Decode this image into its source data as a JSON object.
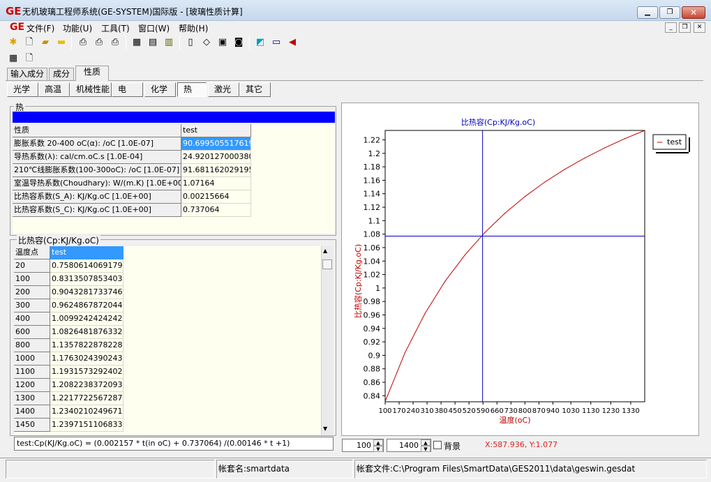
{
  "window": {
    "logo": "GE",
    "title": "无机玻璃工程师系统(GE-SYSTEM)国际版 - [玻璃性质计算]"
  },
  "menu": {
    "logo": "GE",
    "items": [
      "文件(F)",
      "功能(U)",
      "工具(T)",
      "窗口(W)",
      "帮助(H)"
    ]
  },
  "toolbar": {
    "icons": [
      "run-icon",
      "new-file-icon",
      "open-folder-icon",
      "folder-icon",
      "print-setup-icon",
      "print-icon",
      "print-preview-icon",
      "grid-icon",
      "form-icon",
      "database-icon",
      "calculator-icon",
      "eraser-icon",
      "document-icon",
      "disk-icon",
      "book-icon",
      "keyboard-icon",
      "speaker-icon",
      "table-icon",
      "report-preview-icon"
    ]
  },
  "tabs": {
    "primary": [
      "输入成分",
      "成分",
      "性质"
    ],
    "primary_active": 2,
    "secondary": [
      "光学",
      "高温",
      "机械性能",
      "电",
      "化学",
      "热",
      "激光",
      "其它"
    ],
    "secondary_active": 5
  },
  "heat_group": {
    "label": "热",
    "bar_color": "#0000ff",
    "header": [
      "性质",
      "test"
    ],
    "rows": [
      [
        "膨胀系数 20-400 oC(α): /oC [1.0E-07]",
        "90.6995055176196"
      ],
      [
        "导热系数(λ): cal/cm.oC.s [1.0E-04]",
        "24.9201270003803"
      ],
      [
        "210℃线膨胀系数(100-300oC): /oC [1.0E-07]",
        "91.681162029195"
      ],
      [
        "室温导热系数(Choudhary): W/(m.K) [1.0E+00]",
        "1.07164"
      ],
      [
        "比热容系数(S_A): KJ/Kg.oC [1.0E+00]",
        "0.00215664"
      ],
      [
        "比热容系数(S_C): KJ/Kg.oC [1.0E+00]",
        "0.737064"
      ]
    ]
  },
  "cp_group": {
    "label": "比热容(Cp:KJ/Kg.oC)",
    "header": [
      "温度点",
      "test"
    ],
    "rows": [
      [
        "20",
        "0.758061406917995"
      ],
      [
        "100",
        "0.831350785340314"
      ],
      [
        "200",
        "0.904328173374613"
      ],
      [
        "300",
        "0.96248678720445"
      ],
      [
        "400",
        "1.00992424242424"
      ],
      [
        "600",
        "1.08264818763326"
      ],
      [
        "800",
        "1.13578228782288"
      ],
      [
        "1000",
        "1.17630243902439"
      ],
      [
        "1100",
        "1.19315732924021"
      ],
      [
        "1200",
        "1.2082238372093"
      ],
      [
        "1300",
        "1.22177225672878"
      ],
      [
        "1400",
        "1.23402102496715"
      ],
      [
        "1450",
        "1.23971511068335"
      ]
    ],
    "formula": "test:Cp(KJ/Kg.oC) = (0.002157 * t(in oC) + 0.737064) /(0.00146 * t +1)"
  },
  "chart_controls": {
    "min": "100",
    "max": "1400",
    "background_label": "背景",
    "cursor_readout": "X:587.936, Y:1.077"
  },
  "status": {
    "account_name": "帐套名:smartdata",
    "account_file": "帐套文件:C:\\Program Files\\SmartData\\GES2011\\data\\geswin.gesdat"
  },
  "chart_data": {
    "type": "line",
    "title": "比热容(Cp:KJ/Kg.oC)",
    "xlabel": "温度(oC)",
    "ylabel": "比热容(Cp:KJ/Kg.oC)",
    "x_ticks": [
      "100",
      "170",
      "240",
      "310",
      "380",
      "450",
      "520",
      "590",
      "660",
      "730",
      "800",
      "870",
      "940",
      "1030",
      "1130",
      "1230",
      "1330"
    ],
    "y_ticks": [
      "0.84",
      "0.86",
      "0.88",
      "0.9",
      "0.92",
      "0.94",
      "0.96",
      "0.98",
      "1",
      "1.02",
      "1.04",
      "1.06",
      "1.08",
      "1.1",
      "1.12",
      "1.14",
      "1.16",
      "1.18",
      "1.2",
      "1.22"
    ],
    "xlim": [
      100,
      1400
    ],
    "ylim": [
      0.831,
      1.234
    ],
    "grid": false,
    "legend_position": "top-right",
    "crosshair": {
      "x": 587.936,
      "y": 1.077
    },
    "series": [
      {
        "name": "test",
        "color": "#c00000",
        "x": [
          100,
          200,
          300,
          400,
          500,
          600,
          700,
          800,
          900,
          1000,
          1100,
          1200,
          1300,
          1400
        ],
        "y": [
          0.8314,
          0.9043,
          0.9625,
          1.0099,
          1.0493,
          1.0826,
          1.1111,
          1.1358,
          1.1574,
          1.1763,
          1.1932,
          1.2082,
          1.2218,
          1.234
        ]
      }
    ]
  }
}
